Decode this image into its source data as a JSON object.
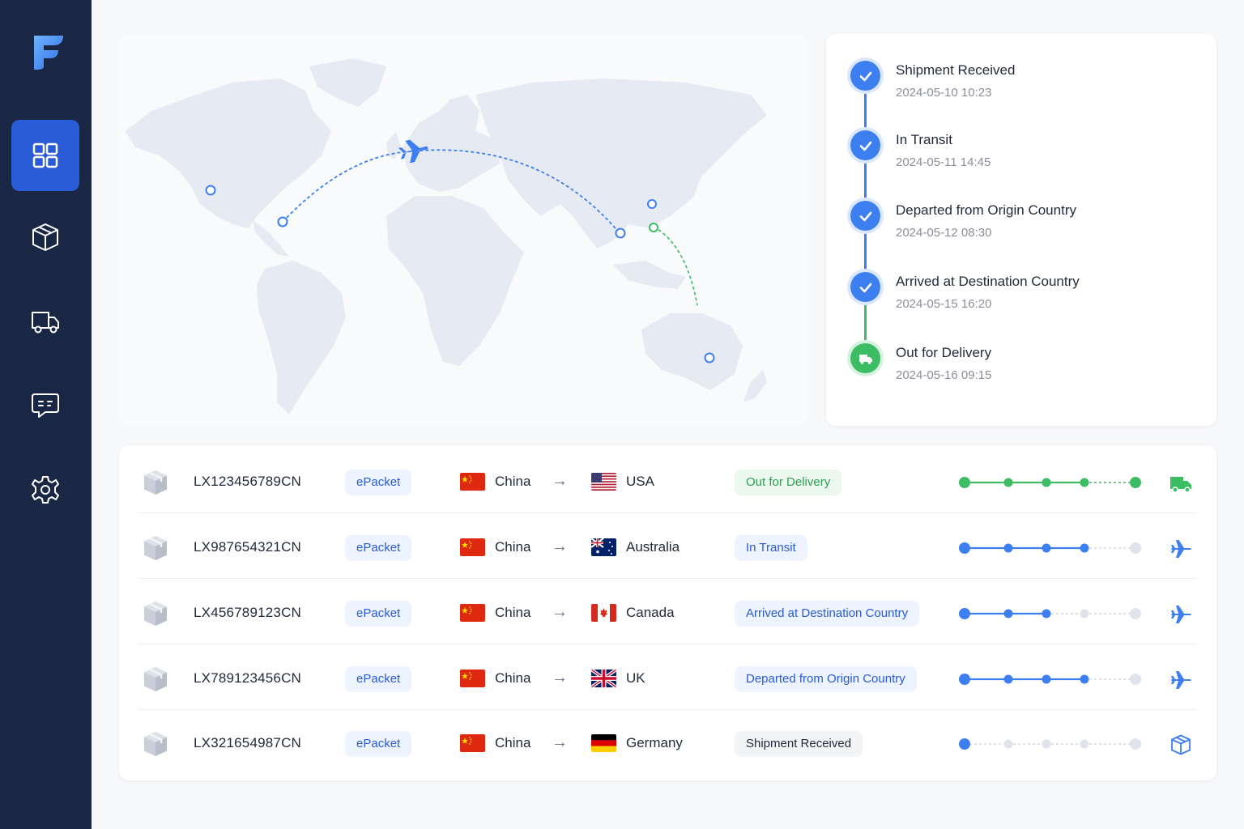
{
  "sidebar": {
    "logo": "logo-f",
    "items": [
      {
        "name": "dashboard",
        "icon": "grid-icon",
        "active": true
      },
      {
        "name": "packages",
        "icon": "box-icon",
        "active": false
      },
      {
        "name": "delivery",
        "icon": "truck-icon",
        "active": false
      },
      {
        "name": "messages",
        "icon": "chat-icon",
        "active": false
      },
      {
        "name": "settings",
        "icon": "gear-icon",
        "active": false
      }
    ]
  },
  "map": {
    "routes": [
      {
        "from": "China",
        "to": "USA",
        "mode": "plane"
      },
      {
        "from": "China",
        "to": "Australia",
        "mode": "ground"
      }
    ]
  },
  "timeline": {
    "events": [
      {
        "title": "Shipment Received",
        "time": "2024-05-10 10:23",
        "state": "done"
      },
      {
        "title": "In Transit",
        "time": "2024-05-11 14:45",
        "state": "done"
      },
      {
        "title": "Departed from Origin Country",
        "time": "2024-05-12 08:30",
        "state": "done"
      },
      {
        "title": "Arrived at Destination Country",
        "time": "2024-05-15 16:20",
        "state": "done"
      },
      {
        "title": "Out for Delivery",
        "time": "2024-05-16 09:15",
        "state": "current"
      }
    ]
  },
  "shipments": {
    "arrow": "→",
    "rows": [
      {
        "tracking": "LX123456789CN",
        "carrier": "ePacket",
        "origin": "China",
        "destination": "USA",
        "dest_flag": "us",
        "status": "Out for Delivery",
        "status_style": "green",
        "steps_done": 5,
        "mode": "truck"
      },
      {
        "tracking": "LX987654321CN",
        "carrier": "ePacket",
        "origin": "China",
        "destination": "Australia",
        "dest_flag": "au",
        "status": "In Transit",
        "status_style": "blue",
        "steps_done": 4,
        "mode": "plane"
      },
      {
        "tracking": "LX456789123CN",
        "carrier": "ePacket",
        "origin": "China",
        "destination": "Canada",
        "dest_flag": "ca",
        "status": "Arrived at Destination Country",
        "status_style": "blue",
        "steps_done": 3,
        "mode": "plane"
      },
      {
        "tracking": "LX789123456CN",
        "carrier": "ePacket",
        "origin": "China",
        "destination": "UK",
        "dest_flag": "uk",
        "status": "Departed from Origin Country",
        "status_style": "blue",
        "steps_done": 4,
        "mode": "plane"
      },
      {
        "tracking": "LX321654987CN",
        "carrier": "ePacket",
        "origin": "China",
        "destination": "Germany",
        "dest_flag": "de",
        "status": "Shipment Received",
        "status_style": "gray",
        "steps_done": 1,
        "mode": "box"
      }
    ]
  },
  "colors": {
    "sidebar": "#1a2744",
    "accent": "#2a5bd7",
    "blue": "#3d7ff0",
    "green": "#3cbd64",
    "inactive": "#d5d9e0"
  }
}
